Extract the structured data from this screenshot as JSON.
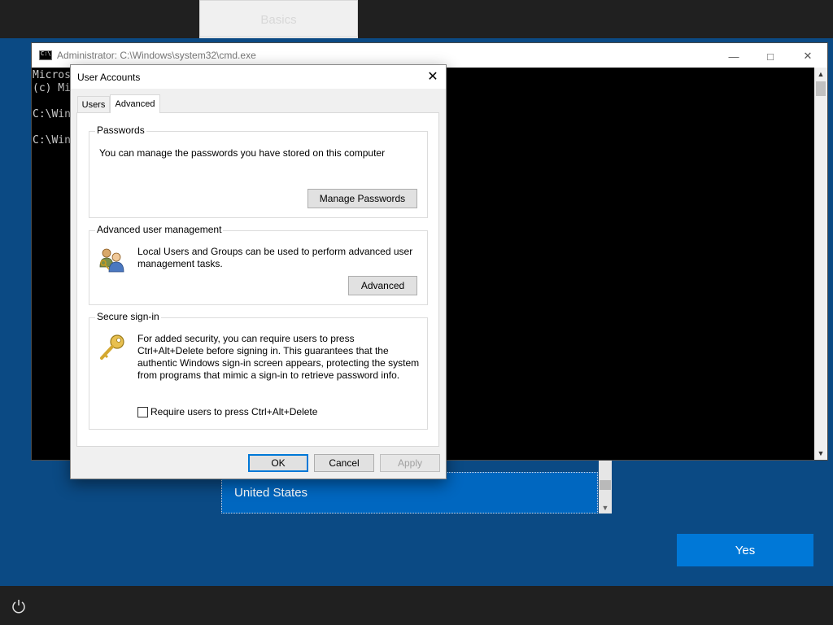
{
  "oobe": {
    "top_tab": "Basics",
    "region_selected": "United States",
    "yes_button": "Yes"
  },
  "cmd": {
    "title": "Administrator: C:\\Windows\\system32\\cmd.exe",
    "lines": [
      "Micros",
      "(c) Mi",
      "",
      "C:\\Win",
      "",
      "C:\\Win"
    ]
  },
  "dialog": {
    "title": "User Accounts",
    "tabs": [
      "Users",
      "Advanced"
    ],
    "active_tab": "Advanced",
    "passwords": {
      "legend": "Passwords",
      "text": "You can manage the passwords you have stored on this computer",
      "button": "Manage Passwords"
    },
    "advanced": {
      "legend": "Advanced user management",
      "text": "Local Users and Groups can be used to perform advanced user management tasks.",
      "button": "Advanced"
    },
    "secure": {
      "legend": "Secure sign-in",
      "text": "For added security, you can require users to press Ctrl+Alt+Delete before signing in. This guarantees that the authentic Windows sign-in screen appears, protecting the system from programs that mimic a sign-in to retrieve password info.",
      "checkbox_label": "Require users to press Ctrl+Alt+Delete",
      "checked": false
    },
    "buttons": {
      "ok": "OK",
      "cancel": "Cancel",
      "apply": "Apply"
    }
  },
  "icons": [
    "power-icon",
    "cmd-app-icon",
    "minimize-icon",
    "maximize-icon",
    "close-icon",
    "users-keys-icon",
    "key-icon",
    "mouse-cursor-icon"
  ],
  "colors": {
    "oobe_blue": "#0b4a84",
    "accent": "#0078d7",
    "selected": "#0067c0",
    "bar": "#202020"
  }
}
